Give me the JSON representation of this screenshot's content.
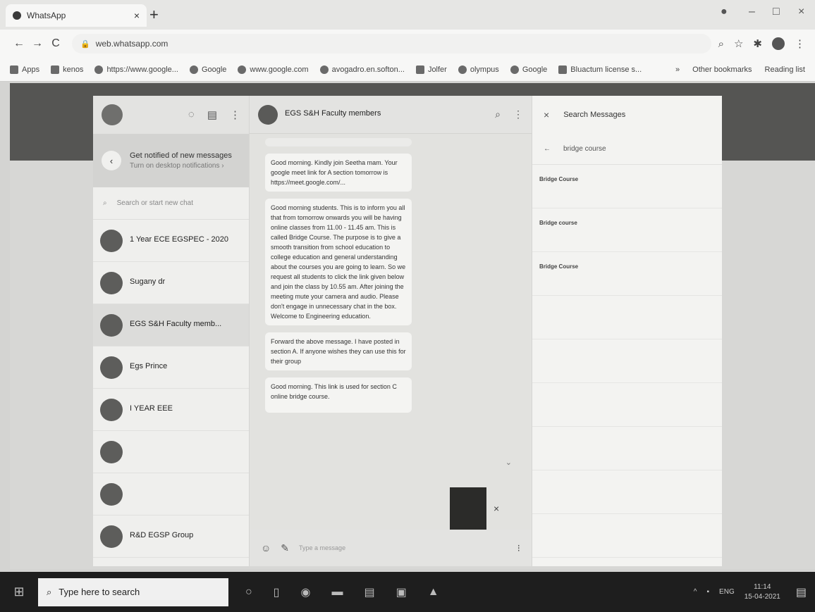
{
  "browser": {
    "tab_title": "WhatsApp",
    "tab_close": "×",
    "new_tab": "+",
    "address": "web.whatsapp.com",
    "back": "←",
    "forward": "→",
    "reload": "C",
    "minimize": "–",
    "maximize": "□"
  },
  "bookmarks": [
    {
      "label": "Apps",
      "icon": "apps-grid-icon"
    },
    {
      "label": "kenos",
      "icon": "bookmark-icon"
    },
    {
      "label": "https://www.google...",
      "icon": "google-icon"
    },
    {
      "label": "Google",
      "icon": "google-icon"
    },
    {
      "label": "www.google.com",
      "icon": "google-icon"
    },
    {
      "label": "avogadro.en.softon...",
      "icon": "site-icon"
    },
    {
      "label": "Jolfer",
      "icon": "bookmark-icon"
    },
    {
      "label": "olympus",
      "icon": "site-icon"
    },
    {
      "label": "Google",
      "icon": "google-icon"
    },
    {
      "label": "Bluactum license s...",
      "icon": "bookmark-icon"
    }
  ],
  "bookmarks_right": {
    "more": "»",
    "other": "Other bookmarks",
    "reading": "Reading list"
  },
  "sidebar": {
    "notify_title": "Get notified of new messages",
    "notify_sub": "Turn on desktop notifications ›",
    "search_placeholder": "Search or start new chat",
    "chats": [
      {
        "name": "1 Year ECE EGSPEC - 2020",
        "snippet": "",
        "active": false
      },
      {
        "name": "Sugany dr",
        "snippet": "",
        "active": false
      },
      {
        "name": "EGS S&H Faculty memb...",
        "snippet": "",
        "active": true
      },
      {
        "name": "Egs Prince",
        "snippet": "",
        "active": false
      },
      {
        "name": "I YEAR EEE",
        "snippet": "",
        "active": false
      },
      {
        "name": "",
        "snippet": "",
        "active": false
      },
      {
        "name": "",
        "snippet": "",
        "active": false
      },
      {
        "name": "R&D EGSP Group",
        "snippet": "",
        "active": false
      }
    ]
  },
  "conversation": {
    "group_name": "EGS S&H Faculty members",
    "members": "",
    "messages": [
      {
        "sender": "",
        "text": "",
        "muted": true
      },
      {
        "sender": "",
        "text": "Good morning. Kindly join Seetha mam. Your google meet link for A section tomorrow is https://meet.google.com/...",
        "muted": false
      },
      {
        "sender": "",
        "text": "Good morning students. This is to inform you all that from tomorrow onwards you will be having online classes from 11.00 - 11.45 am. This is called Bridge Course. The purpose is to give a smooth transition from school education to college education and general understanding about the courses you are going to learn. So we request all students to click the link given below and join the class by 10.55 am. After joining the meeting mute your camera and audio. Please don't engage in unnecessary chat in the box. Welcome to Engineering education.",
        "muted": false
      },
      {
        "sender": "",
        "text": "Forward the above message. I have posted in section A. If anyone wishes they can use this for their group",
        "muted": false
      },
      {
        "sender": "",
        "text": "Good morning. This link is used for section C online bridge course. ",
        "quote": "",
        "muted": false
      }
    ],
    "composer_placeholder": "Type a message"
  },
  "search_panel": {
    "title": "Search Messages",
    "query": "bridge course",
    "results": [
      {
        "date": "",
        "pre": "",
        "hit": "Bridge Course",
        "post": ""
      },
      {
        "date": "",
        "pre": "",
        "hit": "Bridge course",
        "post": ""
      },
      {
        "date": "",
        "pre": "",
        "hit": "Bridge Course",
        "post": ""
      },
      {
        "date": "",
        "pre": "",
        "hit": "",
        "post": ""
      },
      {
        "date": "",
        "pre": "",
        "hit": "",
        "post": ""
      },
      {
        "date": "",
        "pre": "",
        "hit": "",
        "post": ""
      },
      {
        "date": "",
        "pre": "",
        "hit": "",
        "post": ""
      },
      {
        "date": "",
        "pre": "",
        "hit": "",
        "post": ""
      },
      {
        "date": "",
        "pre": "",
        "hit": "",
        "post": ""
      }
    ]
  },
  "taskbar": {
    "search_placeholder": "Type here to search",
    "lang": "ENG",
    "time": "11:14",
    "date": "15-04-2021"
  },
  "colors": {
    "page_band": "#555553",
    "taskbar": "#1e1e1e"
  }
}
